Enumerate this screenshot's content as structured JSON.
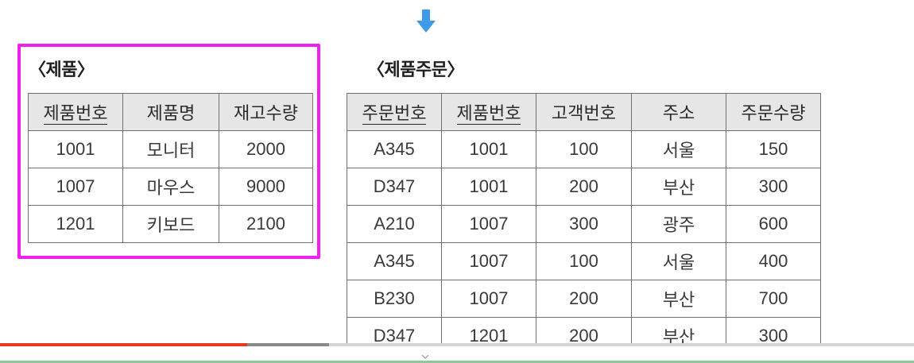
{
  "colors": {
    "arrow": "#3d9be9",
    "highlight": "#f020f0",
    "header_bg": "#e6e6e6",
    "progress_played": "#e8391d",
    "progress_buffered": "#8a8a8a"
  },
  "arrow_icon": "arrow-down-icon",
  "product_table": {
    "caption": "〈제품〉",
    "headers": [
      "제품번호",
      "제품명",
      "재고수량"
    ],
    "rows": [
      [
        "1001",
        "모니터",
        "2000"
      ],
      [
        "1007",
        "마우스",
        "9000"
      ],
      [
        "1201",
        "키보드",
        "2100"
      ]
    ]
  },
  "order_table": {
    "caption": "〈제품주문〉",
    "headers": [
      "주문번호",
      "제품번호",
      "고객번호",
      "주소",
      "주문수량"
    ],
    "rows": [
      [
        "A345",
        "1001",
        "100",
        "서울",
        "150"
      ],
      [
        "D347",
        "1001",
        "200",
        "부산",
        "300"
      ],
      [
        "A210",
        "1007",
        "300",
        "광주",
        "600"
      ],
      [
        "A345",
        "1007",
        "100",
        "서울",
        "400"
      ],
      [
        "B230",
        "1007",
        "200",
        "부산",
        "700"
      ],
      [
        "D347",
        "1201",
        "200",
        "부산",
        "300"
      ]
    ]
  },
  "video_progress": {
    "played_fraction": 0.27,
    "buffered_fraction": 0.36
  }
}
